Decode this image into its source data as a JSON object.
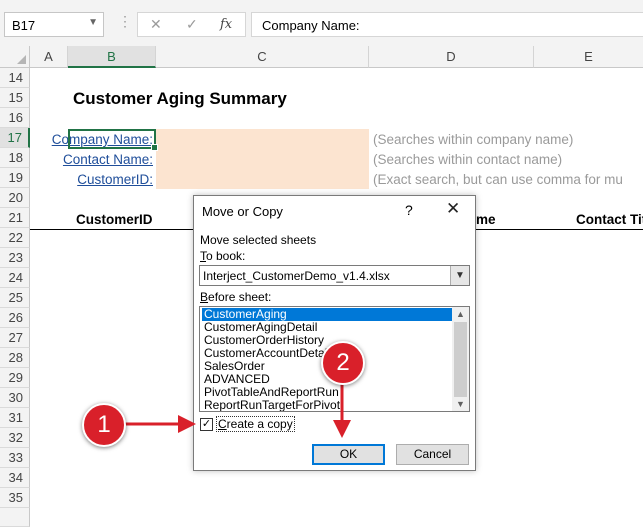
{
  "formula_bar": {
    "name_box": "B17",
    "cancel_glyph": "✕",
    "enter_glyph": "✓",
    "fx_label": "fx",
    "formula": "Company Name:"
  },
  "columns": [
    "A",
    "B",
    "C",
    "D",
    "E"
  ],
  "rows": [
    "14",
    "15",
    "16",
    "17",
    "18",
    "19",
    "20",
    "21",
    "22",
    "23",
    "24",
    "25",
    "26",
    "27",
    "28",
    "29",
    "30",
    "31",
    "32",
    "33",
    "34",
    "35"
  ],
  "sheet": {
    "title": "Customer Aging Summary",
    "filters": [
      {
        "label": "Company Name:",
        "hint": "(Searches within company name)"
      },
      {
        "label": "Contact Name:",
        "hint": "(Searches within contact name)"
      },
      {
        "label": "CustomerID:",
        "hint": "(Exact search, but can use comma for mu"
      }
    ],
    "headers": {
      "customer_id": "CustomerID",
      "partial": "me",
      "contact_title": "Contact Titl"
    }
  },
  "dialog": {
    "title": "Move or Copy",
    "help": "?",
    "close": "✕",
    "move_label": "Move selected sheets",
    "to_book_label_first": "T",
    "to_book_label_rest": "o book:",
    "to_book_value": "Interject_CustomerDemo_v1.4.xlsx",
    "before_sheet_label_first": "B",
    "before_sheet_label_rest": "efore sheet:",
    "sheets": [
      "CustomerAging",
      "CustomerAgingDetail",
      "CustomerOrderHistory",
      "CustomerAccountDetail",
      "SalesOrder",
      "ADVANCED",
      "PivotTableAndReportRun",
      "ReportRunTargetForPivot"
    ],
    "selected_sheet": "CustomerAging",
    "create_copy_first": "C",
    "create_copy_rest": "reate a copy",
    "create_copy_checked": true,
    "check_glyph": "✓",
    "ok_label": "OK",
    "cancel_label": "Cancel"
  },
  "annotations": {
    "badge1": "1",
    "badge2": "2",
    "color": "#d9202a"
  }
}
